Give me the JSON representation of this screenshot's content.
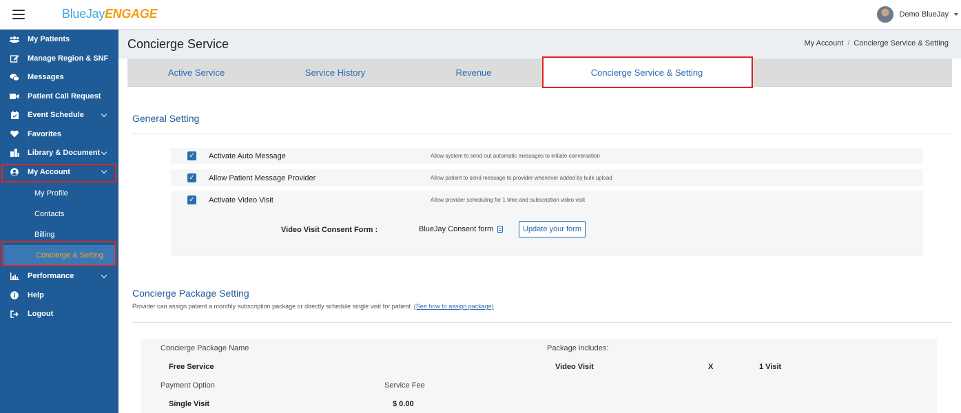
{
  "header": {
    "logo_blue": "BlueJay",
    "logo_orange": "ENGAGE",
    "user_name": "Demo BlueJay"
  },
  "sidebar": {
    "items": [
      {
        "label": "My Patients",
        "icon": "users-icon"
      },
      {
        "label": "Manage Region & SNF",
        "icon": "edit-icon"
      },
      {
        "label": "Messages",
        "icon": "chat-icon"
      },
      {
        "label": "Patient Call Request",
        "icon": "video-icon"
      },
      {
        "label": "Event Schedule",
        "icon": "calendar-icon"
      },
      {
        "label": "Favorites",
        "icon": "heart-icon"
      },
      {
        "label": "Library & Document",
        "icon": "library-icon"
      },
      {
        "label": "My Account",
        "icon": "user-circle-icon"
      }
    ],
    "sub_items": [
      "My Profile",
      "Contacts",
      "Billing",
      "Concierge & Setting"
    ],
    "bottom_items": [
      {
        "label": "Performance",
        "icon": "chart-icon"
      },
      {
        "label": "Help",
        "icon": "info-icon"
      },
      {
        "label": "Logout",
        "icon": "logout-icon"
      }
    ]
  },
  "page": {
    "title": "Concierge Service",
    "breadcrumb": [
      "My Account",
      "Concierge Service & Setting"
    ]
  },
  "tabs": [
    "Active Service",
    "Service History",
    "Revenue",
    "Concierge Service & Setting"
  ],
  "general": {
    "title": "General Setting",
    "settings": [
      {
        "label": "Activate Auto Message",
        "desc": "Allow system to send out automatic messages to initiate conversation",
        "checked": true
      },
      {
        "label": "Allow Patient Message Provider",
        "desc": "Allow patient to send message to provider whenever added by bulk upload",
        "checked": true
      },
      {
        "label": "Activate Video Visit",
        "desc": "Allow provider scheduling for 1 time and subscription video visit",
        "checked": true
      }
    ],
    "consent_label": "Video Visit Consent Form :",
    "consent_file": "BlueJay Consent form",
    "update_button": "Update your form"
  },
  "package": {
    "title": "Concierge Package Setting",
    "desc": "Provider can assign patient a monthly subscription package or directly schedule single visit for patient.",
    "link": "(See how to assign package)",
    "name_label": "Concierge Package Name",
    "name_value": "Free Service",
    "includes_label": "Package includes:",
    "includes_item": "Video Visit",
    "includes_x": "X",
    "includes_qty": "1 Visit",
    "payment_label": "Payment Option",
    "payment_value": "Single Visit",
    "fee_label": "Service Fee",
    "fee_value": "$ 0.00"
  },
  "colors": {
    "sidebar": "#1f5c97",
    "accent": "#2a6db0",
    "highlight": "#e0261b",
    "active_sub": "#f5a623"
  }
}
